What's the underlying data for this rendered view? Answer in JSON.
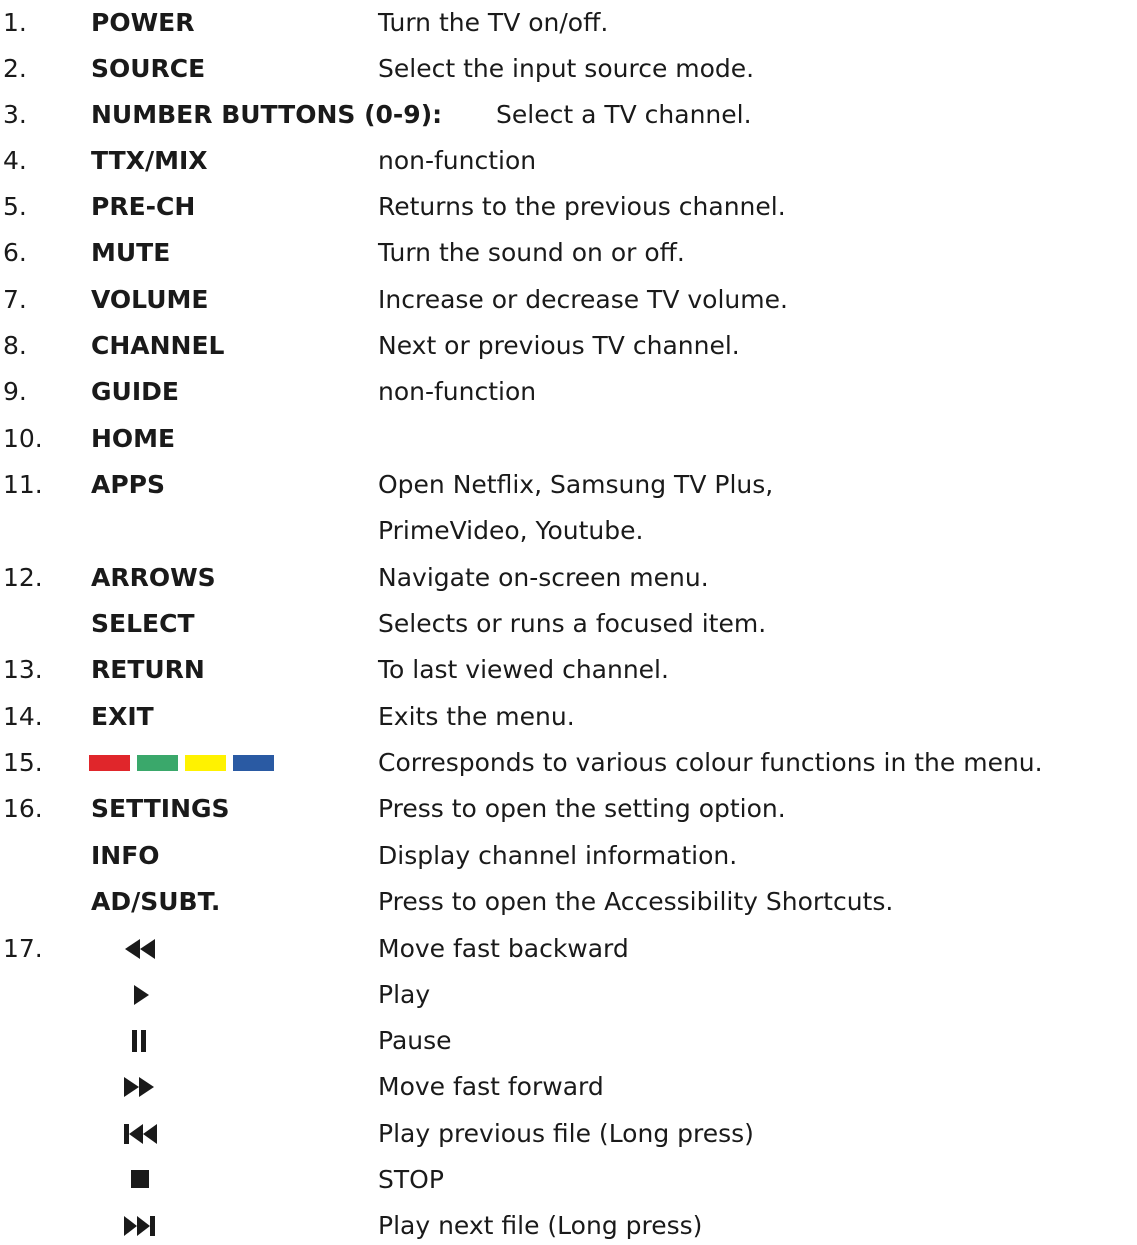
{
  "rows": [
    {
      "num": "1.",
      "key": "POWER",
      "desc": "Turn the TV on/off."
    },
    {
      "num": "2.",
      "key": "SOURCE",
      "desc": "Select the input source mode."
    },
    {
      "num": "3.",
      "key": "NUMBER BUTTONS (0-9):",
      "desc": "Select a TV channel."
    },
    {
      "num": "4.",
      "key": "TTX/MIX",
      "desc": "non-function"
    },
    {
      "num": "5.",
      "key": "PRE-CH",
      "desc": "Returns to the previous channel."
    },
    {
      "num": "6.",
      "key": "MUTE",
      "desc": "Turn the sound on or off."
    },
    {
      "num": "7.",
      "key": "VOLUME",
      "desc": "Increase or decrease TV volume."
    },
    {
      "num": "8.",
      "key": "CHANNEL",
      "desc": "Next or previous TV channel."
    },
    {
      "num": "9.",
      "key": "GUIDE",
      "desc": "non-function"
    },
    {
      "num": "10.",
      "key": "HOME",
      "desc": ""
    },
    {
      "num": "11.",
      "key": "APPS",
      "desc": "Open Netflix, Samsung TV Plus,"
    },
    {
      "num": "",
      "key": "",
      "desc": "PrimeVideo, Youtube."
    },
    {
      "num": "12.",
      "key": "ARROWS",
      "desc": "Navigate on-screen menu."
    },
    {
      "num": "",
      "key": "SELECT",
      "desc": "Selects or runs a focused item."
    },
    {
      "num": "13.",
      "key": "RETURN",
      "desc": "To last viewed channel."
    },
    {
      "num": "14.",
      "key": "EXIT",
      "desc": "Exits the menu."
    },
    {
      "num": "15.",
      "key": "",
      "desc": "Corresponds to various colour functions in the menu."
    },
    {
      "num": "16.",
      "key": "SETTINGS",
      "desc": "Press to open the setting option."
    },
    {
      "num": "",
      "key": "INFO",
      "desc": "Display channel information."
    },
    {
      "num": "",
      "key": "AD/SUBT.",
      "desc": "Press to open the Accessibility Shortcuts."
    },
    {
      "num": "17.",
      "key": "",
      "desc": "Move fast backward"
    },
    {
      "num": "",
      "key": "",
      "desc": "Play"
    },
    {
      "num": "",
      "key": "",
      "desc": "Pause"
    },
    {
      "num": "",
      "key": "",
      "desc": "Move fast forward"
    },
    {
      "num": "",
      "key": "",
      "desc": "Play previous file (Long press)"
    },
    {
      "num": "",
      "key": "",
      "desc": "STOP"
    },
    {
      "num": "",
      "key": "",
      "desc": "Play next file (Long press)"
    }
  ],
  "colour_swatches": [
    "#e0262b",
    "#3aa86b",
    "#fff200",
    "#2a5aa3"
  ],
  "media_icons": [
    "rewind-icon",
    "play-icon",
    "pause-icon",
    "fast-forward-icon",
    "previous-icon",
    "stop-icon",
    "next-icon"
  ],
  "text_color": "#1a1a1a"
}
